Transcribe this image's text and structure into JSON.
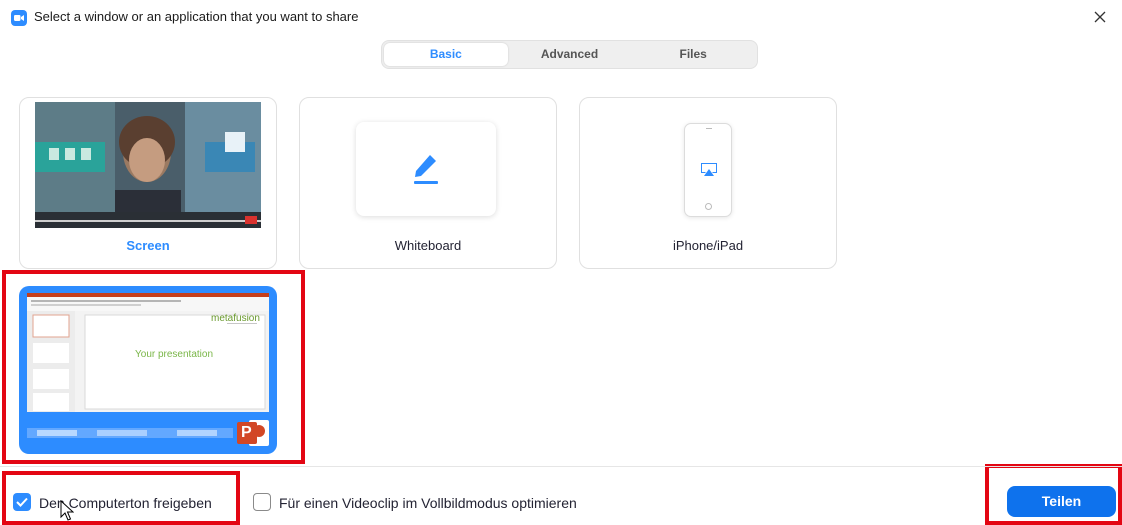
{
  "window": {
    "title": "Select a window or an application that you want to share",
    "close_icon": "close-icon",
    "accent_color": "#2d8cff"
  },
  "tabs": [
    {
      "label": "Basic",
      "active": true
    },
    {
      "label": "Advanced",
      "active": false
    },
    {
      "label": "Files",
      "active": false
    }
  ],
  "cards": {
    "screen": {
      "label": "Screen",
      "selected": false
    },
    "whiteboard": {
      "label": "Whiteboard",
      "icon": "pencil-icon"
    },
    "iphone": {
      "label": "iPhone/iPad",
      "icon": "airplay-icon"
    }
  },
  "app_window": {
    "slide_brand": "metafusion",
    "slide_title": "Your presentation",
    "app_icon": "powerpoint-icon",
    "app_icon_letter": "P",
    "selected": true
  },
  "footer": {
    "computer_sound_label": "Den Computerton freigeben",
    "computer_sound_checked": true,
    "video_optimize_label": "Für einen Videoclip im Vollbildmodus optimieren",
    "video_optimize_checked": false,
    "share_button_label": "Teilen"
  }
}
